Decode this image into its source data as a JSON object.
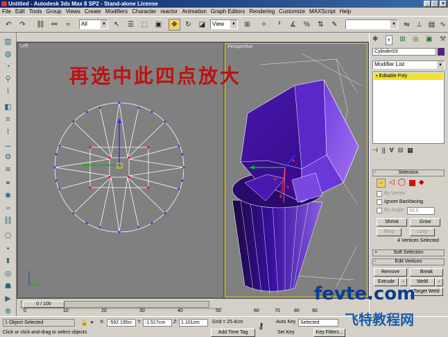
{
  "window": {
    "title": "Untitled - Autodesk 3ds Max 8 SP2  -  Stand-alone License"
  },
  "menu": [
    "File",
    "Edit",
    "Tools",
    "Group",
    "Views",
    "Create",
    "Modifiers",
    "Character",
    "reactor",
    "Animation",
    "Graph Editors",
    "Rendering",
    "Customize",
    "MAXScript",
    "Help"
  ],
  "toolbar": {
    "selection_filter": "All",
    "ref_coord": "View",
    "named_selection": ""
  },
  "viewports": {
    "left": {
      "label": "Left"
    },
    "perspective": {
      "label": "Perspective"
    }
  },
  "annotation": "再选中此四点放大",
  "command_panel": {
    "object_name": "Cylinder03",
    "object_color": "#5a1a9a",
    "modifier_list": "Modifier List",
    "stack_item": "Editable Poly",
    "selection": {
      "title": "Selection",
      "by_vertex": "By Vertex",
      "ignore_backfacing": "Ignore Backfacing",
      "by_angle": "By Angle:",
      "angle_value": "45.0",
      "shrink": "Shrink",
      "grow": "Grow",
      "ring": "Ring",
      "loop": "Loop",
      "status": "4 Vertices Selected"
    },
    "soft_selection": "Soft Selection",
    "edit_vertices": {
      "title": "Edit Vertices",
      "remove": "Remove",
      "break": "Break",
      "extrude": "Extrude",
      "weld": "Weld",
      "target_weld": "Target Weld"
    }
  },
  "timeline": {
    "frame": "0 / 100",
    "ticks": [
      "0",
      "10",
      "20",
      "30",
      "40",
      "50",
      "60",
      "70",
      "80",
      "90"
    ]
  },
  "status": {
    "selected": "1 Object Selected",
    "prompt": "Click or click-and-drag to select objects",
    "x": "-592.195cr",
    "y": "-1.517cm",
    "z": "1.101cm",
    "grid": "Grid = 25.4cm",
    "add_time_tag": "Add Time Tag",
    "auto_key": "Auto Key",
    "set_key": "Set Key",
    "selected_combo": "Selected",
    "key_filters": "Key Filters..."
  },
  "watermark": {
    "top": "fevte.com",
    "bottom": "飞特教程网"
  },
  "colors": {
    "accent": "#f0d060",
    "object": "#4a10a0",
    "selection_red": "#c01010"
  }
}
